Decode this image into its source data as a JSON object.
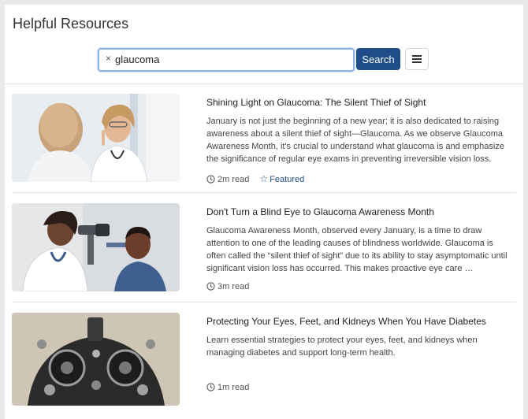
{
  "page": {
    "title": "Helpful Resources"
  },
  "search": {
    "value": "glaucoma",
    "clear_label": "×",
    "button_label": "Search"
  },
  "articles": [
    {
      "title": "Shining Light on Glaucoma: The Silent Thief of Sight",
      "excerpt": "January is not just the beginning of a new year; it is also dedicated to raising awareness about a silent thief of sight—Glaucoma. As we observe Glaucoma Awareness Month, it's crucial to understand what glaucoma is and emphasize the significance of regular eye exams in preventing irreversible vision loss.",
      "read_time": "2m read",
      "badge": "Featured",
      "image": "doctor-eye-exam-image"
    },
    {
      "title": "Don't Turn a Blind Eye to Glaucoma Awareness Month",
      "excerpt": "Glaucoma Awareness Month, observed every January, is a time to draw attention to one of the leading causes of blindness worldwide. Glaucoma is often called the “silent thief of sight” due to its ability to stay asymptomatic until significant vision loss has occurred. This makes proactive eye care …",
      "read_time": "3m read",
      "image": "patient-slit-lamp-image"
    },
    {
      "title": "Protecting Your Eyes, Feet, and Kidneys When You Have Diabetes",
      "excerpt": "Learn essential strategies to protect your eyes, feet, and kidneys when managing diabetes and support long-term health.",
      "read_time": "1m read",
      "image": "phoropter-image"
    }
  ],
  "colors": {
    "accent": "#1f4d87",
    "focus_ring": "#8fb4e6"
  }
}
